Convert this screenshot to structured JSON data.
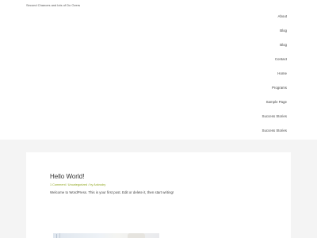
{
  "site": {
    "tagline": "Second Chances and lots of Do Overs"
  },
  "nav": {
    "items": [
      {
        "label": "About"
      },
      {
        "label": "Blog"
      },
      {
        "label": "Blog"
      },
      {
        "label": "Contact"
      },
      {
        "label": "Home"
      },
      {
        "label": "Programs"
      },
      {
        "label": "Sample Page"
      },
      {
        "label": "Success Stories"
      },
      {
        "label": "Success Stories"
      }
    ]
  },
  "post": {
    "title": "Hello World!",
    "meta": "1 Comment / Uncategorized / by Axkrodry",
    "excerpt": "Welcome to WordPress. This is your first post. Edit or delete it, then start writing!"
  },
  "colors": {
    "background": "#f4f4f4",
    "surface": "#ffffff",
    "accent": "#8fa61e",
    "text": "#444444"
  }
}
